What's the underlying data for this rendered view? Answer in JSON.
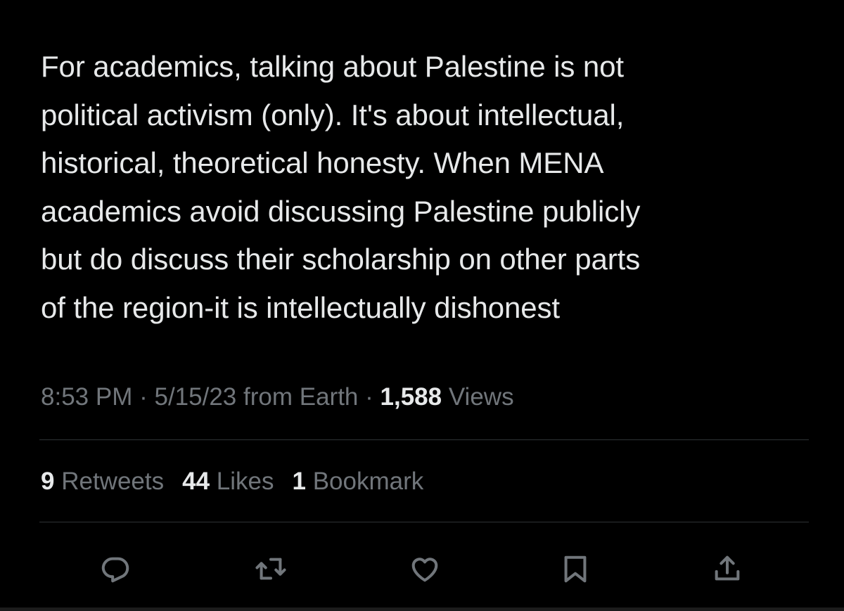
{
  "tweet": {
    "text": "For academics, talking about Palestine is not\npolitical activism (only). It's about intellectual,\nhistorical, theoretical honesty. When MENA\nacademics avoid discussing Palestine publicly\nbut do discuss their scholarship on other parts\nof the region-it is intellectually dishonest",
    "time": "8:53 PM",
    "separator": "·",
    "date": "5/15/23",
    "source": "from Earth",
    "views_count": "1,588",
    "views_label": "Views"
  },
  "stats": {
    "retweets_count": "9",
    "retweets_label": "Retweets",
    "likes_count": "44",
    "likes_label": "Likes",
    "bookmarks_count": "1",
    "bookmarks_label": "Bookmark"
  },
  "actions": [
    {
      "icon": "reply-icon"
    },
    {
      "icon": "retweet-icon"
    },
    {
      "icon": "like-icon"
    },
    {
      "icon": "bookmark-icon"
    },
    {
      "icon": "share-icon"
    }
  ],
  "colors": {
    "background": "#000000",
    "primary_text": "#e7e9ea",
    "secondary_text": "#71767b",
    "divider": "#2f3336"
  }
}
